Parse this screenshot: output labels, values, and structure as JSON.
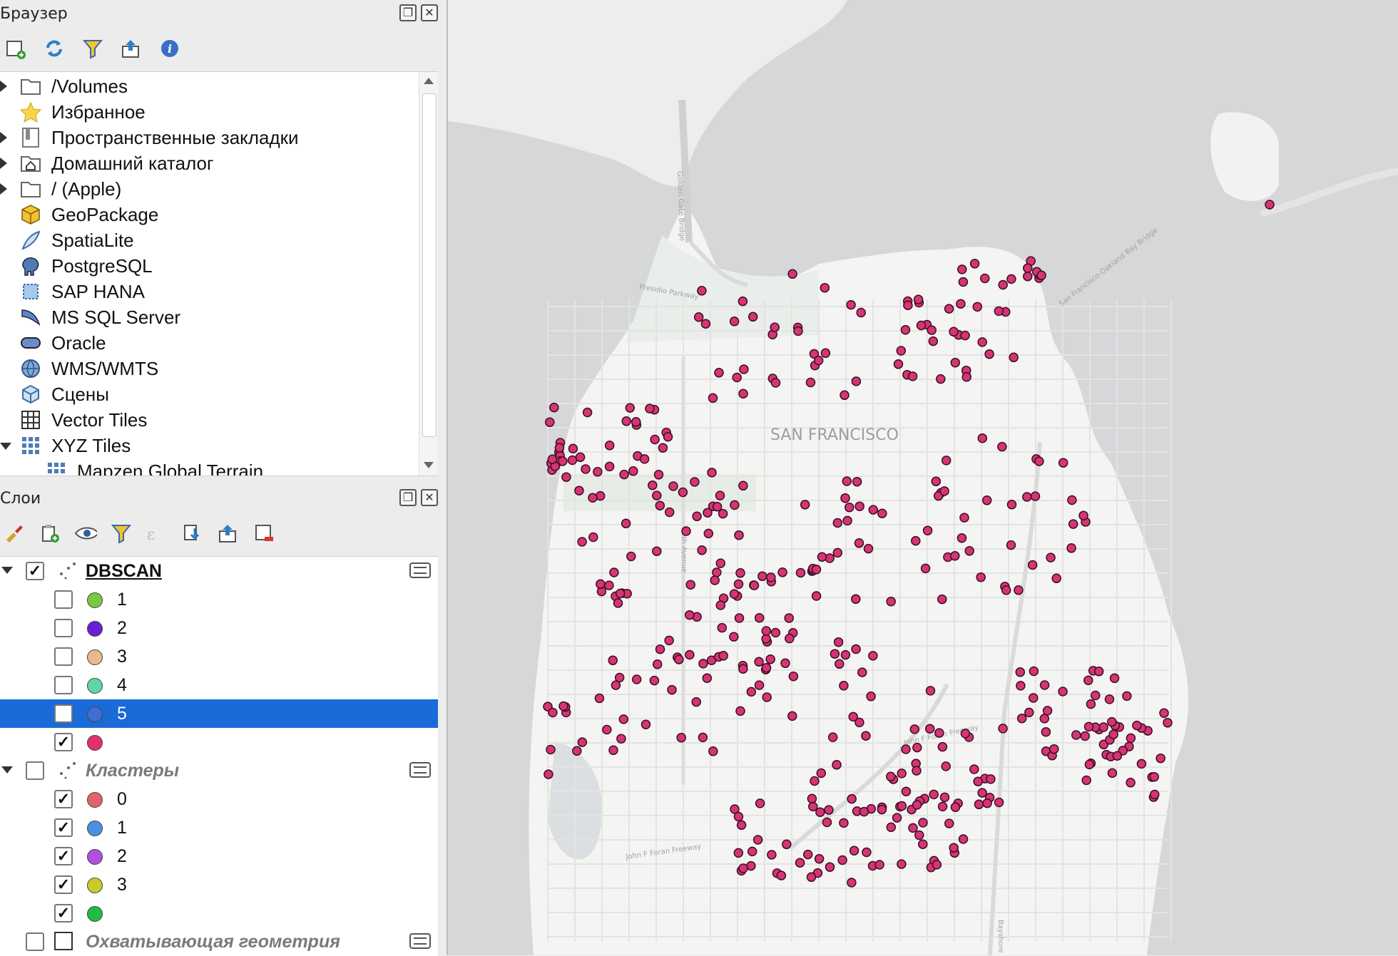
{
  "browser_panel": {
    "title": "Браузер",
    "toolbar": [
      "add-layer-icon",
      "refresh-icon",
      "filter-icon",
      "collapse-icon",
      "info-icon"
    ],
    "items": [
      {
        "label": "/Volumes",
        "icon": "folder-icon",
        "expander": "right"
      },
      {
        "label": "Избранное",
        "icon": "star-icon",
        "expander": ""
      },
      {
        "label": "Пространственные закладки",
        "icon": "bookmark-icon",
        "expander": "right"
      },
      {
        "label": "Домашний каталог",
        "icon": "home-folder-icon",
        "expander": "right"
      },
      {
        "label": "/ (Apple)",
        "icon": "folder-icon",
        "expander": "right"
      },
      {
        "label": "GeoPackage",
        "icon": "geopackage-icon",
        "expander": ""
      },
      {
        "label": "SpatiaLite",
        "icon": "feather-icon",
        "expander": ""
      },
      {
        "label": "PostgreSQL",
        "icon": "elephant-icon",
        "expander": ""
      },
      {
        "label": "SAP HANA",
        "icon": "sap-hana-icon",
        "expander": ""
      },
      {
        "label": "MS SQL Server",
        "icon": "mssql-icon",
        "expander": ""
      },
      {
        "label": "Oracle",
        "icon": "oracle-icon",
        "expander": ""
      },
      {
        "label": "WMS/WMTS",
        "icon": "globe-icon",
        "expander": ""
      },
      {
        "label": "Сцены",
        "icon": "cube-icon",
        "expander": ""
      },
      {
        "label": "Vector Tiles",
        "icon": "grid-icon",
        "expander": ""
      },
      {
        "label": "XYZ Tiles",
        "icon": "dot-grid-icon",
        "expander": "down"
      },
      {
        "label": "Mapzen Global Terrain",
        "icon": "dot-grid-icon",
        "expander": ""
      }
    ]
  },
  "layers_panel": {
    "title": "Слои",
    "toolbar": [
      "style-icon",
      "add-group-icon",
      "visibility-icon",
      "filter-icon",
      "expression-icon",
      "expand-icon",
      "collapse-icon",
      "remove-icon"
    ],
    "layers": [
      {
        "name": "DBSCAN",
        "checked": true,
        "expanded": true,
        "bold": true,
        "classes": [
          {
            "label": "1",
            "color": "#7ac943",
            "checked": false,
            "selected": false
          },
          {
            "label": "2",
            "color": "#6a1fd6",
            "checked": false,
            "selected": false
          },
          {
            "label": "3",
            "color": "#e8b98a",
            "checked": false,
            "selected": false
          },
          {
            "label": "4",
            "color": "#5fd6a4",
            "checked": false,
            "selected": false
          },
          {
            "label": "5",
            "color": "#3d6fd1",
            "checked": false,
            "selected": true
          },
          {
            "label": "",
            "color": "#e0306f",
            "checked": true,
            "selected": false
          }
        ]
      },
      {
        "name": "Кластеры",
        "checked": false,
        "expanded": true,
        "bold": false,
        "classes": [
          {
            "label": "0",
            "color": "#e0646a",
            "checked": true,
            "selected": false
          },
          {
            "label": "1",
            "color": "#4a90e2",
            "checked": true,
            "selected": false
          },
          {
            "label": "2",
            "color": "#b14fe0",
            "checked": true,
            "selected": false
          },
          {
            "label": "3",
            "color": "#c7cc2a",
            "checked": true,
            "selected": false
          },
          {
            "label": "",
            "color": "#22bb44",
            "checked": true,
            "selected": false
          }
        ]
      },
      {
        "name": "Охватывающая геометрия",
        "checked": false,
        "expanded": false,
        "bold": false,
        "classes": []
      }
    ]
  },
  "map": {
    "labels": {
      "city": "SAN FRANCISCO",
      "presidio": "Presidio Parkway",
      "golden_gate": "Golden Gate Bridge",
      "bay_bridge": "San Francisco-Oakland Bay Bridge",
      "foran": "John F Foran Freeway",
      "foran2": "John F Foran Freeway",
      "ave19": "19th Avenue",
      "bayshore": "Bayshore"
    },
    "point_color": "#d63476",
    "land_color": "#f4f4f3",
    "water_color": "#d5d7d9"
  }
}
